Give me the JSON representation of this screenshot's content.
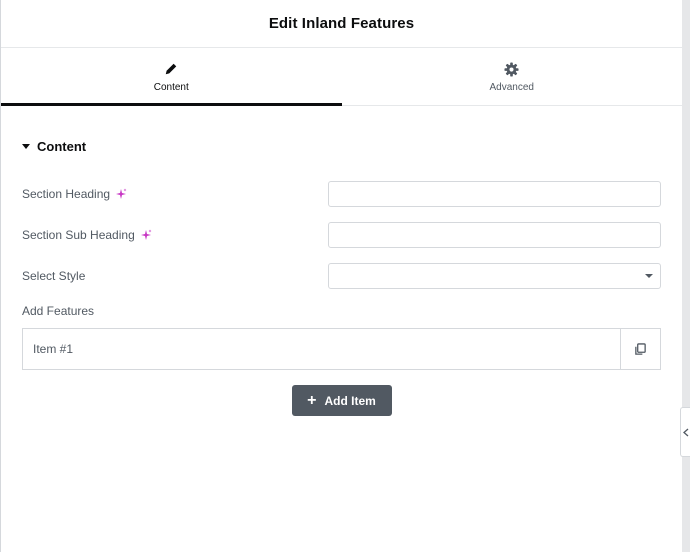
{
  "header": {
    "title": "Edit Inland Features"
  },
  "tabs": [
    {
      "label": "Content",
      "icon": "pencil-icon",
      "active": true
    },
    {
      "label": "Advanced",
      "icon": "gear-icon",
      "active": false
    }
  ],
  "section": {
    "title": "Content"
  },
  "fields": {
    "section_heading": {
      "label": "Section Heading",
      "value": ""
    },
    "section_sub_heading": {
      "label": "Section Sub Heading",
      "value": ""
    },
    "select_style": {
      "label": "Select Style",
      "value": ""
    }
  },
  "features": {
    "label": "Add Features",
    "items": [
      {
        "title": "Item #1"
      }
    ],
    "add_label": "Add Item"
  },
  "colors": {
    "ai_accent": "#c737c4",
    "button_bg": "#515962",
    "active_tab": "#0c0d0e"
  }
}
